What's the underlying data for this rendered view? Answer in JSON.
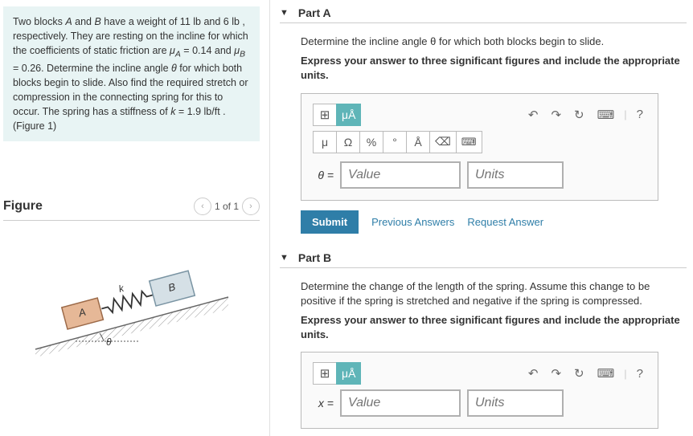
{
  "problem": {
    "text_html": "Two blocks <i>A</i> and <i>B</i> have a weight of 11 lb and 6 lb , respectively. They are resting on the incline for which the coefficients of static friction are <i>μ<sub>A</sub></i> = 0.14 and <i>μ<sub>B</sub></i> = 0.26. Determine the incline angle <i>θ</i> for which both blocks begin to slide. Also find the required stretch or compression in the connecting spring for this to occur. The spring has a stiffness of <i>k</i> = 1.9 lb/ft . (Figure 1)"
  },
  "figure": {
    "title": "Figure",
    "page_current": 1,
    "page_total": 1,
    "labels": {
      "A": "A",
      "B": "B",
      "k": "k",
      "theta": "θ"
    }
  },
  "partA": {
    "title": "Part A",
    "prompt": "Determine the incline angle θ for which both blocks begin to slide.",
    "format": "Express your answer to three significant figures and include the appropriate units.",
    "answer_symbol": "θ =",
    "value_placeholder": "Value",
    "units_placeholder": "Units",
    "toolbar": {
      "templates": "⊞",
      "ua_active": "μÅ",
      "undo": "↶",
      "redo": "↷",
      "reset": "↻",
      "keyboard": "⌨",
      "help": "?",
      "mu": "μ",
      "omega": "Ω",
      "percent": "%",
      "degree": "°",
      "angstrom": "Å",
      "backspace": "⌫",
      "kb2": "⌨"
    },
    "submit": "Submit",
    "prev_answers": "Previous Answers",
    "request_answer": "Request Answer"
  },
  "partB": {
    "title": "Part B",
    "prompt": "Determine the change of the length of the spring. Assume this change to be positive if the spring is stretched and negative if the spring is compressed.",
    "format": "Express your answer to three significant figures and include the appropriate units.",
    "answer_symbol": "x =",
    "value_placeholder": "Value",
    "units_placeholder": "Units",
    "toolbar": {
      "templates": "⊞",
      "ua_active": "μÅ",
      "undo": "↶",
      "redo": "↷",
      "reset": "↻",
      "keyboard": "⌨",
      "help": "?"
    }
  }
}
